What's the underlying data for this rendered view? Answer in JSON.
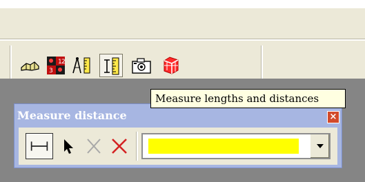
{
  "toolbar": {
    "buttons": [
      {
        "icon": "handshake-icon"
      },
      {
        "icon": "color-numbered-grid-icon"
      },
      {
        "icon": "compass-ruler-icon"
      },
      {
        "icon": "measure-ruler-icon",
        "active": true
      },
      {
        "icon": "camera-icon"
      },
      {
        "icon": "red-3d-box-icon"
      }
    ]
  },
  "tooltip": {
    "text": "Measure lengths and distances"
  },
  "measure_window": {
    "title": "Measure distance",
    "close_symbol": "×",
    "tools": [
      {
        "icon": "measure-line-icon"
      },
      {
        "icon": "arrow-select-icon"
      },
      {
        "icon": "gray-x-icon"
      },
      {
        "icon": "red-x-icon"
      }
    ],
    "line_color": "#ffff00",
    "title_bar_color": "#a7b6e2"
  }
}
